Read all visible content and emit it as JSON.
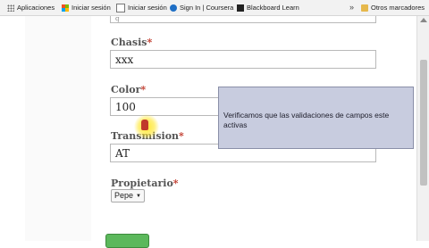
{
  "bookmarks": [
    {
      "label": "Aplicaciones",
      "icon": "apps-grid-icon"
    },
    {
      "label": "Iniciar sesión",
      "icon": "microsoft-logo-icon"
    },
    {
      "label": "Iniciar sesión",
      "icon": "page-icon"
    },
    {
      "label": "Sign In | Coursera",
      "icon": "coursera-icon"
    },
    {
      "label": "Blackboard Learn",
      "icon": "blackboard-icon"
    },
    {
      "label": "Otros marcadores",
      "icon": "folder-icon"
    }
  ],
  "bookmarks_more": "»",
  "form": {
    "top_input_value": "q",
    "chasis": {
      "label": "Chasis",
      "value": "xxx"
    },
    "color": {
      "label": "Color",
      "value": "100"
    },
    "transmision": {
      "label": "Transmision",
      "value": "AT"
    },
    "propietario": {
      "label": "Propietario",
      "selected": "Pepe"
    },
    "required_mark": "*"
  },
  "tooltip": {
    "text": "Verificamos que las validaciones de campos este activas"
  },
  "colors": {
    "submit": "#5cb85c",
    "tooltip_bg": "#c8ccdf",
    "required": "#c0392b"
  }
}
